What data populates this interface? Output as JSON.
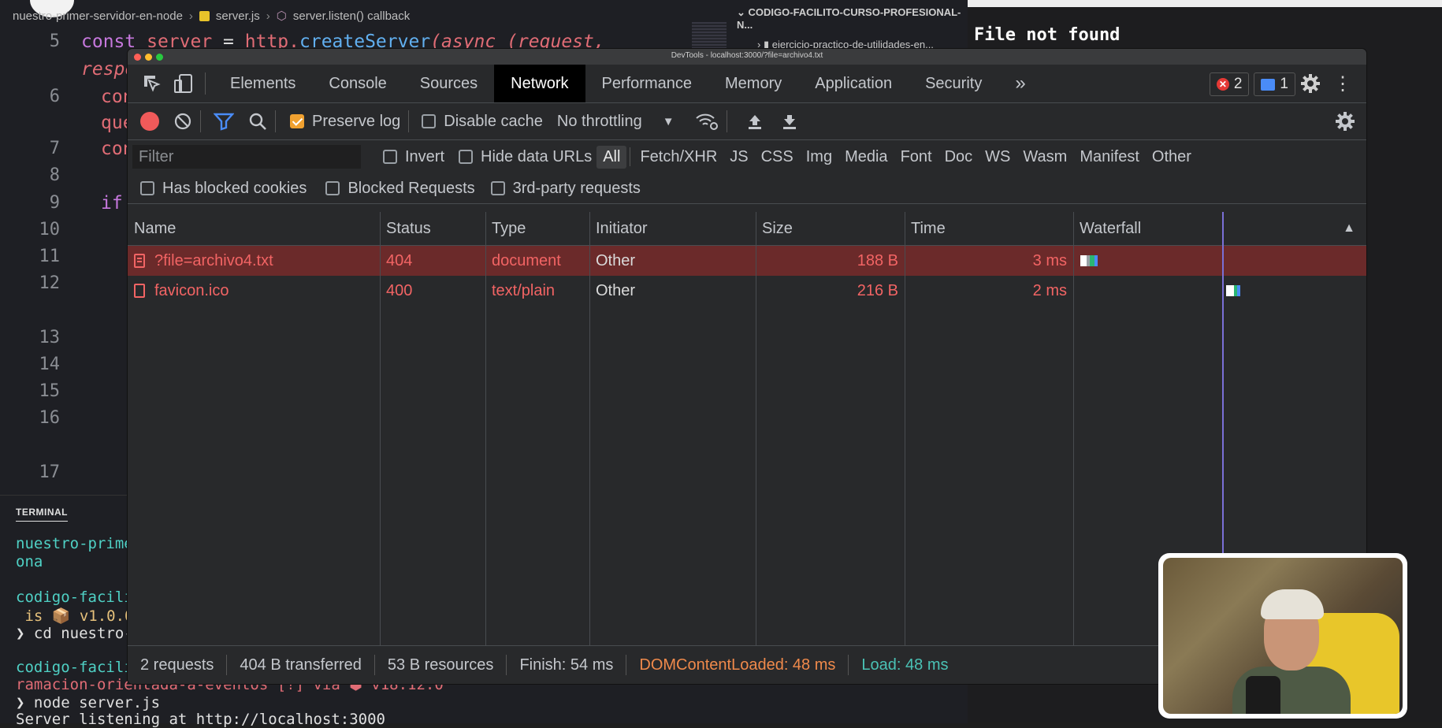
{
  "editor": {
    "breadcrumb": [
      "nuestro-primer-servidor-en-node",
      "server.js",
      "server.listen() callback"
    ],
    "explorer_root": "CODIGO-FACILITO-CURSO-PROFESIONAL-N...",
    "explorer_item": "ejercicio-practico-de-utilidades-en...",
    "line_numbers": [
      "5",
      "6",
      "7",
      "8",
      "9",
      "10",
      "11",
      "12",
      "13",
      "14",
      "15",
      "16",
      "17"
    ],
    "code": {
      "line5_const": "const",
      "line5_server": "server",
      "line5_eq": " = ",
      "line5_http": "http.",
      "line5_create": "createServer",
      "line5_rest": "(async (request,",
      "line5b": "respo",
      "line6": "con",
      "line6b": "que",
      "line7": "con",
      "line9": "if"
    }
  },
  "terminal": {
    "title": "TERMINAL",
    "lines": [
      "nuestro-prime",
      "ona",
      "codigo-facili",
      " is 📦 v1.0.0",
      "❯ cd nuestro-",
      "codigo-facili",
      "ramacion-orientada-a-eventos [!] via ⬢ v18.12.0",
      "❯ node server.js",
      "Server listening at http://localhost:3000"
    ]
  },
  "browser": {
    "message": "File not found"
  },
  "devtools": {
    "window_title": "DevTools - localhost:3000/?file=archivo4.txt",
    "tabs": [
      "Elements",
      "Console",
      "Sources",
      "Network",
      "Performance",
      "Memory",
      "Application",
      "Security"
    ],
    "active_tab": "Network",
    "more_tabs": "»",
    "error_count": "2",
    "message_count": "1",
    "toolbar": {
      "preserve_log": "Preserve log",
      "disable_cache": "Disable cache",
      "throttling": "No throttling"
    },
    "filter": {
      "placeholder": "Filter",
      "invert": "Invert",
      "hide_data_urls": "Hide data URLs",
      "types": [
        "All",
        "Fetch/XHR",
        "JS",
        "CSS",
        "Img",
        "Media",
        "Font",
        "Doc",
        "WS",
        "Wasm",
        "Manifest",
        "Other"
      ],
      "has_blocked_cookies": "Has blocked cookies",
      "blocked_requests": "Blocked Requests",
      "third_party": "3rd-party requests"
    },
    "columns": [
      "Name",
      "Status",
      "Type",
      "Initiator",
      "Size",
      "Time",
      "Waterfall"
    ],
    "requests": [
      {
        "name": "?file=archivo4.txt",
        "status": "404",
        "type": "document",
        "initiator": "Other",
        "size": "188 B",
        "time": "3 ms"
      },
      {
        "name": "favicon.ico",
        "status": "400",
        "type": "text/plain",
        "initiator": "Other",
        "size": "216 B",
        "time": "2 ms"
      }
    ],
    "status": {
      "requests": "2 requests",
      "transferred": "404 B transferred",
      "resources": "53 B resources",
      "finish": "Finish: 54 ms",
      "dom_content_loaded": "DOMContentLoaded: 48 ms",
      "load": "Load: 48 ms"
    }
  },
  "colors": {
    "error_red": "#f26464",
    "dcl_orange": "#f08a4b",
    "load_teal": "#4ac2b5",
    "preserve_orange": "#f0a130"
  }
}
